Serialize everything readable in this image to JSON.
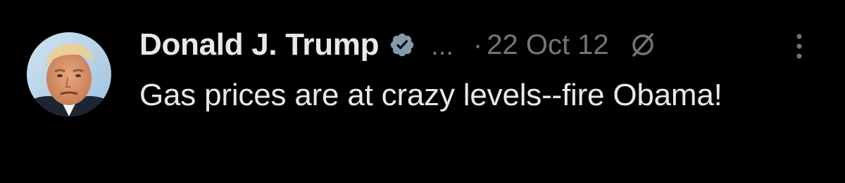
{
  "tweet": {
    "author": {
      "display_name": "Donald J. Trump",
      "verified_icon": "verified-badge-icon",
      "handle_truncated": "...",
      "avatar": "profile-photo"
    },
    "separator": "·",
    "timestamp": "22 Oct 12",
    "edited_icon": "slashed-circle-icon",
    "more_icon": "vertical-ellipsis-icon",
    "text": "Gas prices are at crazy levels--fire Obama!"
  },
  "colors": {
    "background": "#000000",
    "primary_text": "#e7e9ea",
    "secondary_text": "#71767b",
    "verified_badge": "#829aab"
  }
}
